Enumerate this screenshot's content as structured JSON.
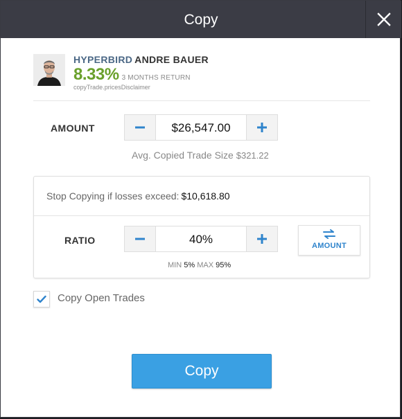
{
  "dialog": {
    "title": "Copy",
    "close_icon": "close-icon"
  },
  "trader": {
    "username": "HYPERBIRD",
    "full_name": "ANDRE BAUER",
    "return_value": "8.33%",
    "return_label": "3 MONTHS RETURN",
    "disclaimer": "copyTrade.pricesDisclaimer",
    "return_color": "#6aa02c"
  },
  "amount": {
    "label": "AMOUNT",
    "value": "$26,547.00",
    "decrement_icon": "minus-icon",
    "increment_icon": "plus-icon",
    "avg_label": "Avg. Copied Trade Size",
    "avg_value": "$321.22"
  },
  "stop_loss": {
    "label": "Stop Copying if losses exceed:",
    "value": "$10,618.80"
  },
  "ratio": {
    "label": "RATIO",
    "value": "40%",
    "switch_label": "AMOUNT",
    "switch_icon": "swap-arrows-icon",
    "min_label": "MIN",
    "min_value": "5%",
    "max_label": "MAX",
    "max_value": "95%"
  },
  "copy_open_trades": {
    "label": "Copy Open Trades",
    "checked": true
  },
  "submit": {
    "label": "Copy"
  },
  "colors": {
    "accent": "#3aa0e3",
    "header_bg": "#3b3c45"
  }
}
